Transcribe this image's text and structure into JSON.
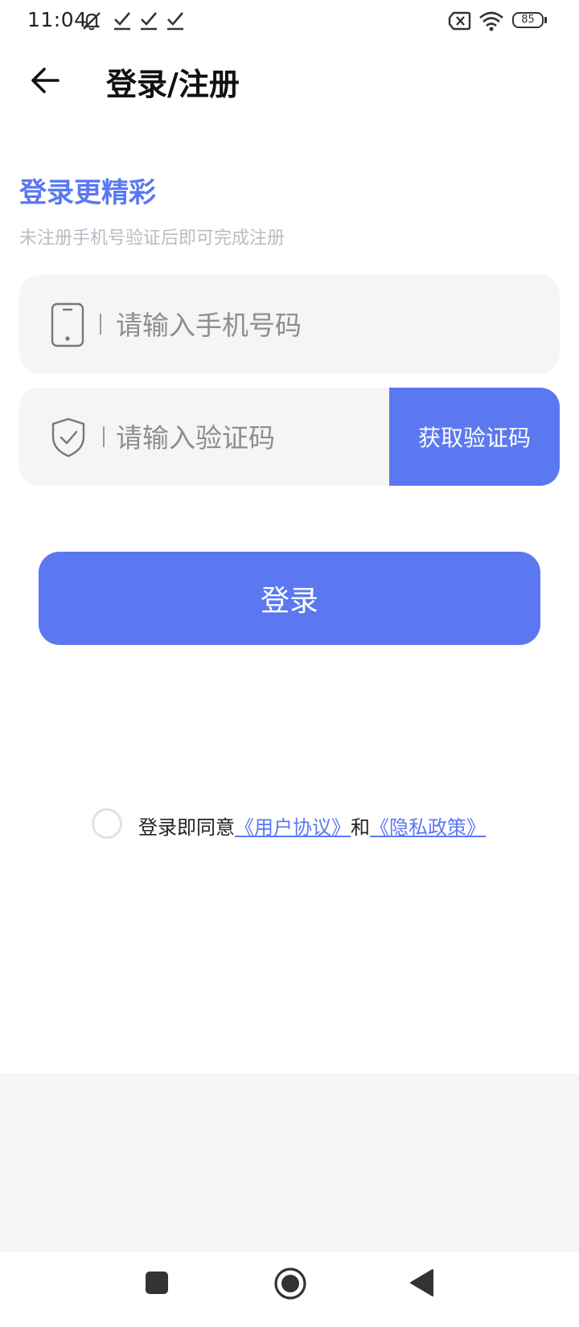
{
  "status_bar": {
    "time": "11:04",
    "battery": "85",
    "icons": [
      "mute-icon",
      "check-icon",
      "check-icon",
      "check-icon",
      "sim-off-icon",
      "wifi-icon",
      "battery-icon"
    ]
  },
  "header": {
    "title": "登录/注册",
    "back_icon": "arrow-left-icon"
  },
  "main": {
    "heading": "登录更精彩",
    "subtext": "未注册手机号验证后即可完成注册",
    "phone_field": {
      "placeholder": "请输入手机号码",
      "value": "",
      "icon": "phone-icon"
    },
    "code_field": {
      "placeholder": "请输入验证码",
      "value": "",
      "icon": "shield-check-icon"
    },
    "get_code_label": "获取验证码",
    "login_label": "登录"
  },
  "agreement": {
    "prefix": "登录即同意",
    "user_agreement": "《用户协议》",
    "connector": "和",
    "privacy_policy": "《隐私政策》",
    "checked": false
  },
  "nav_bar": {
    "icons": [
      "recents-square-icon",
      "home-circle-icon",
      "back-triangle-icon"
    ]
  },
  "colors": {
    "accent": "#5b78f0",
    "field_bg": "#f5f5f5",
    "subtext": "#b9bcc4"
  }
}
